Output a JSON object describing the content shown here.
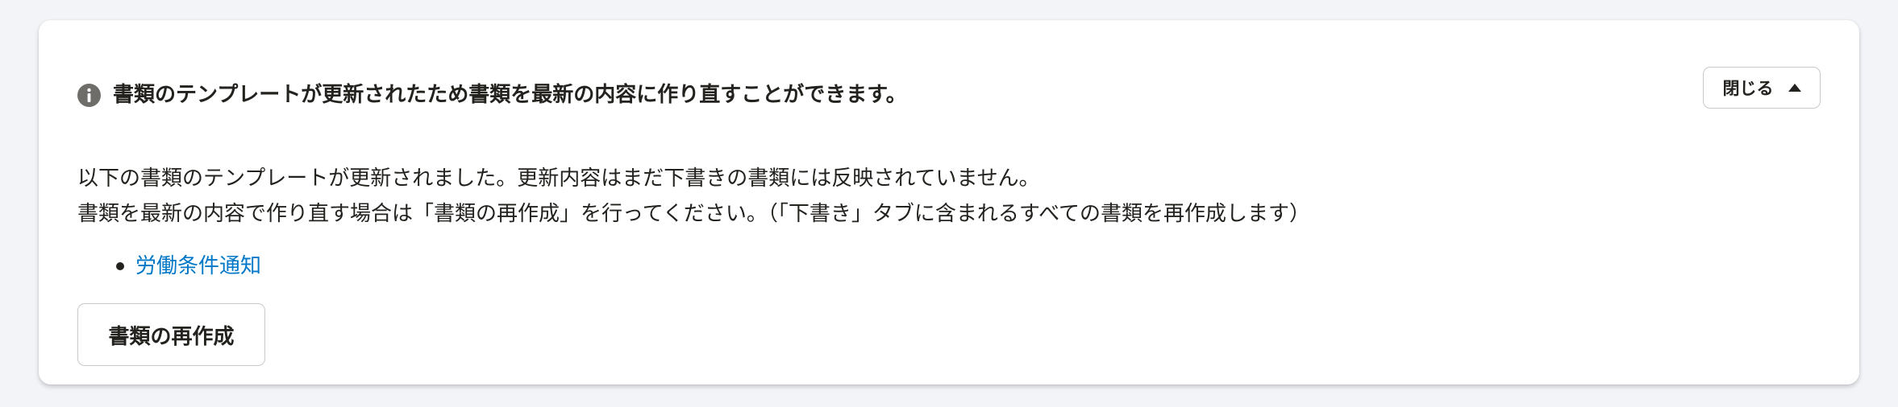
{
  "notice": {
    "icon": "info-circle-icon",
    "title": "書類のテンプレートが更新されたため書類を最新の内容に作り直すことができます。",
    "close_label": "閉じる",
    "close_icon": "caret-up-icon",
    "message_line1": "以下の書類のテンプレートが更新されました。更新内容はまだ下書きの書類には反映されていません。",
    "message_line2": "書類を最新の内容で作り直す場合は「書類の再作成」を行ってください。（「下書き」タブに含まれるすべての書類を再作成します）",
    "documents": [
      {
        "label": "労働条件通知"
      }
    ],
    "recreate_label": "書類の再作成"
  },
  "colors": {
    "background": "#f3f4f8",
    "panel": "#ffffff",
    "text": "#23221e",
    "link": "#0077c7",
    "icon": "#6e6d69",
    "border": "#c9c8c4"
  }
}
